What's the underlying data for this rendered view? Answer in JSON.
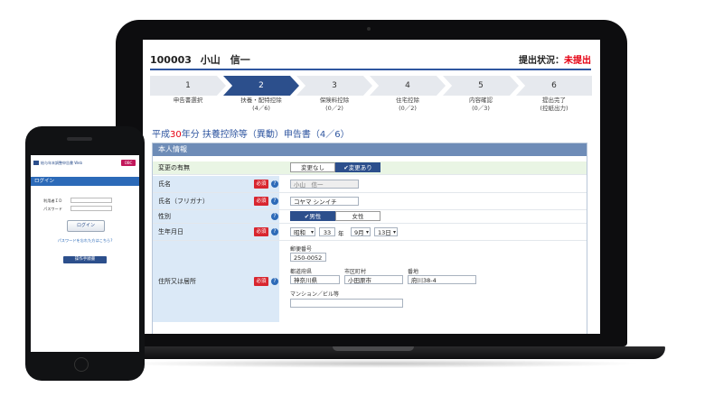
{
  "laptop": {
    "header": {
      "user_id": "100003",
      "user_name": "小山　信一",
      "status_label": "提出状況：",
      "status_value": "未提出"
    },
    "steps": [
      {
        "num": "1",
        "label": "申告書選択",
        "sub": ""
      },
      {
        "num": "2",
        "label": "扶養・配特控除",
        "sub": "(4／6)"
      },
      {
        "num": "3",
        "label": "保険料控除",
        "sub": "(0／2)"
      },
      {
        "num": "4",
        "label": "住宅控除",
        "sub": "(0／2)"
      },
      {
        "num": "5",
        "label": "内容確認",
        "sub": "(0／3)"
      },
      {
        "num": "6",
        "label": "提出完了",
        "sub": "(控紙出力)"
      }
    ],
    "form_title": {
      "prefix": "平成",
      "year": "30",
      "suffix": "年分 扶養控除等（異動）申告書（4／6）"
    },
    "section_title": "本人情報",
    "change": {
      "label": "変更の有無",
      "option_no": "変更なし",
      "option_yes": "✔変更あり"
    },
    "required_badge": "必須",
    "help_icon": "?",
    "name": {
      "label": "氏名",
      "value": "小山　信一"
    },
    "kana": {
      "label": "氏名（フリガナ）",
      "value": "コヤマ シンイチ"
    },
    "gender": {
      "label": "性別",
      "male": "✔男性",
      "female": "女性"
    },
    "birthday": {
      "label": "生年月日",
      "era": "昭和",
      "year": "33",
      "year_unit": "年",
      "month": "9月",
      "day": "13日"
    },
    "address": {
      "label": "住所又は居所",
      "postal_label": "郵便番号",
      "postal": "250-0052",
      "pref_label": "都道府県",
      "pref": "神奈川県",
      "city_label": "市区町村",
      "city": "小田原市",
      "block_label": "番地",
      "block": "府川38-4",
      "building_label": "マンション／ビル等",
      "building": ""
    }
  },
  "phone": {
    "brand": "給与年末調整申告書 Web",
    "badge": "OBC",
    "bar_title": "ログイン",
    "user_label": "利用者ＩＤ",
    "pass_label": "パスワード",
    "login_button": "ログイン",
    "forgot_link": "パスワードを忘れた方はこちら?",
    "guide_button": "操作手順書"
  }
}
